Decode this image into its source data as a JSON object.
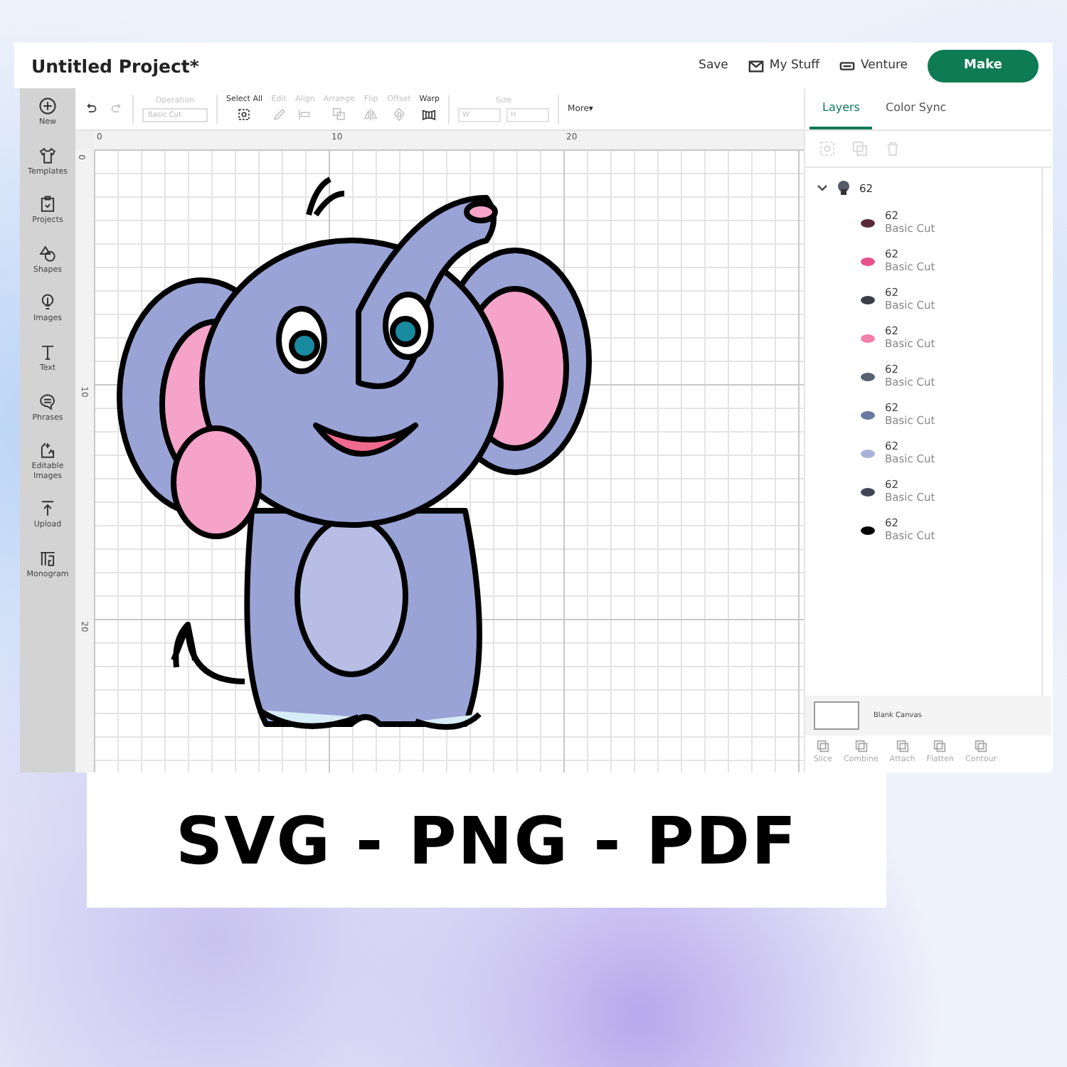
{
  "header": {
    "title": "Untitled Project*",
    "links": [
      {
        "label": "Save",
        "kind": "plain"
      },
      {
        "label": "My Stuff",
        "kind": "mail"
      },
      {
        "label": "Venture",
        "kind": "machine"
      }
    ],
    "make_button": "Make"
  },
  "sidebar": {
    "items": [
      {
        "label": "New",
        "kind": "plus"
      },
      {
        "label": "Templates",
        "kind": "shirt"
      },
      {
        "label": "Projects",
        "kind": "clipboard"
      },
      {
        "label": "Shapes",
        "kind": "shapes"
      },
      {
        "label": "Images",
        "kind": "bulb"
      },
      {
        "label": "Text",
        "kind": "text"
      },
      {
        "label": "Phrases",
        "kind": "bubble"
      },
      {
        "label": "Editable Images",
        "kind": "edit"
      },
      {
        "label": "Upload",
        "kind": "upload"
      },
      {
        "label": "Monogram",
        "kind": "monogram"
      }
    ]
  },
  "toolbar": {
    "items": [
      {
        "kind": "undo",
        "disabled": false
      },
      {
        "kind": "redo",
        "disabled": true
      },
      {
        "kind": "operation",
        "label": "Operation",
        "value": "Basic Cut",
        "disabled": true
      },
      {
        "kind": "select",
        "label": "Select All",
        "disabled": false
      },
      {
        "kind": "edit",
        "label": "Edit",
        "disabled": true
      },
      {
        "kind": "align",
        "label": "Align",
        "disabled": true
      },
      {
        "kind": "arrange",
        "label": "Arrange",
        "disabled": true
      },
      {
        "kind": "flip",
        "label": "Flip",
        "disabled": true
      },
      {
        "kind": "offset",
        "label": "Offset",
        "disabled": true
      },
      {
        "kind": "warp",
        "label": "Warp",
        "disabled": false
      },
      {
        "kind": "size",
        "label": "Size",
        "w": "W",
        "h": "H",
        "disabled": true
      },
      {
        "kind": "more",
        "label": "More▾",
        "disabled": false
      }
    ]
  },
  "canvas": {
    "top_ruler": [
      "0",
      "10",
      "20"
    ],
    "left_ruler": [
      "0",
      "10",
      "20"
    ]
  },
  "layers_panel": {
    "tabs": [
      {
        "label": "Layers",
        "selected": true
      },
      {
        "label": "Color Sync",
        "selected": false
      }
    ],
    "group": {
      "name": "62",
      "expanded": true,
      "children": [
        {
          "name": "62",
          "operation": "Basic Cut",
          "color": "#5a2a3a"
        },
        {
          "name": "62",
          "operation": "Basic Cut",
          "color": "#e8508a"
        },
        {
          "name": "62",
          "operation": "Basic Cut",
          "color": "#3a3f4a"
        },
        {
          "name": "62",
          "operation": "Basic Cut",
          "color": "#f080a8"
        },
        {
          "name": "62",
          "operation": "Basic Cut",
          "color": "#556070"
        },
        {
          "name": "62",
          "operation": "Basic Cut",
          "color": "#6878a0"
        },
        {
          "name": "62",
          "operation": "Basic Cut",
          "color": "#a8b2d8"
        },
        {
          "name": "62",
          "operation": "Basic Cut",
          "color": "#404656"
        },
        {
          "name": "62",
          "operation": "Basic Cut",
          "color": "#000000"
        }
      ]
    },
    "blank_canvas": "Blank Canvas",
    "tools": [
      {
        "label": "Slice",
        "disabled": true
      },
      {
        "label": "Combine",
        "disabled": true
      },
      {
        "label": "Attach",
        "disabled": true
      },
      {
        "label": "Flatten",
        "disabled": true
      },
      {
        "label": "Contour",
        "disabled": true
      }
    ]
  },
  "banner": "SVG - PNG - PDF"
}
